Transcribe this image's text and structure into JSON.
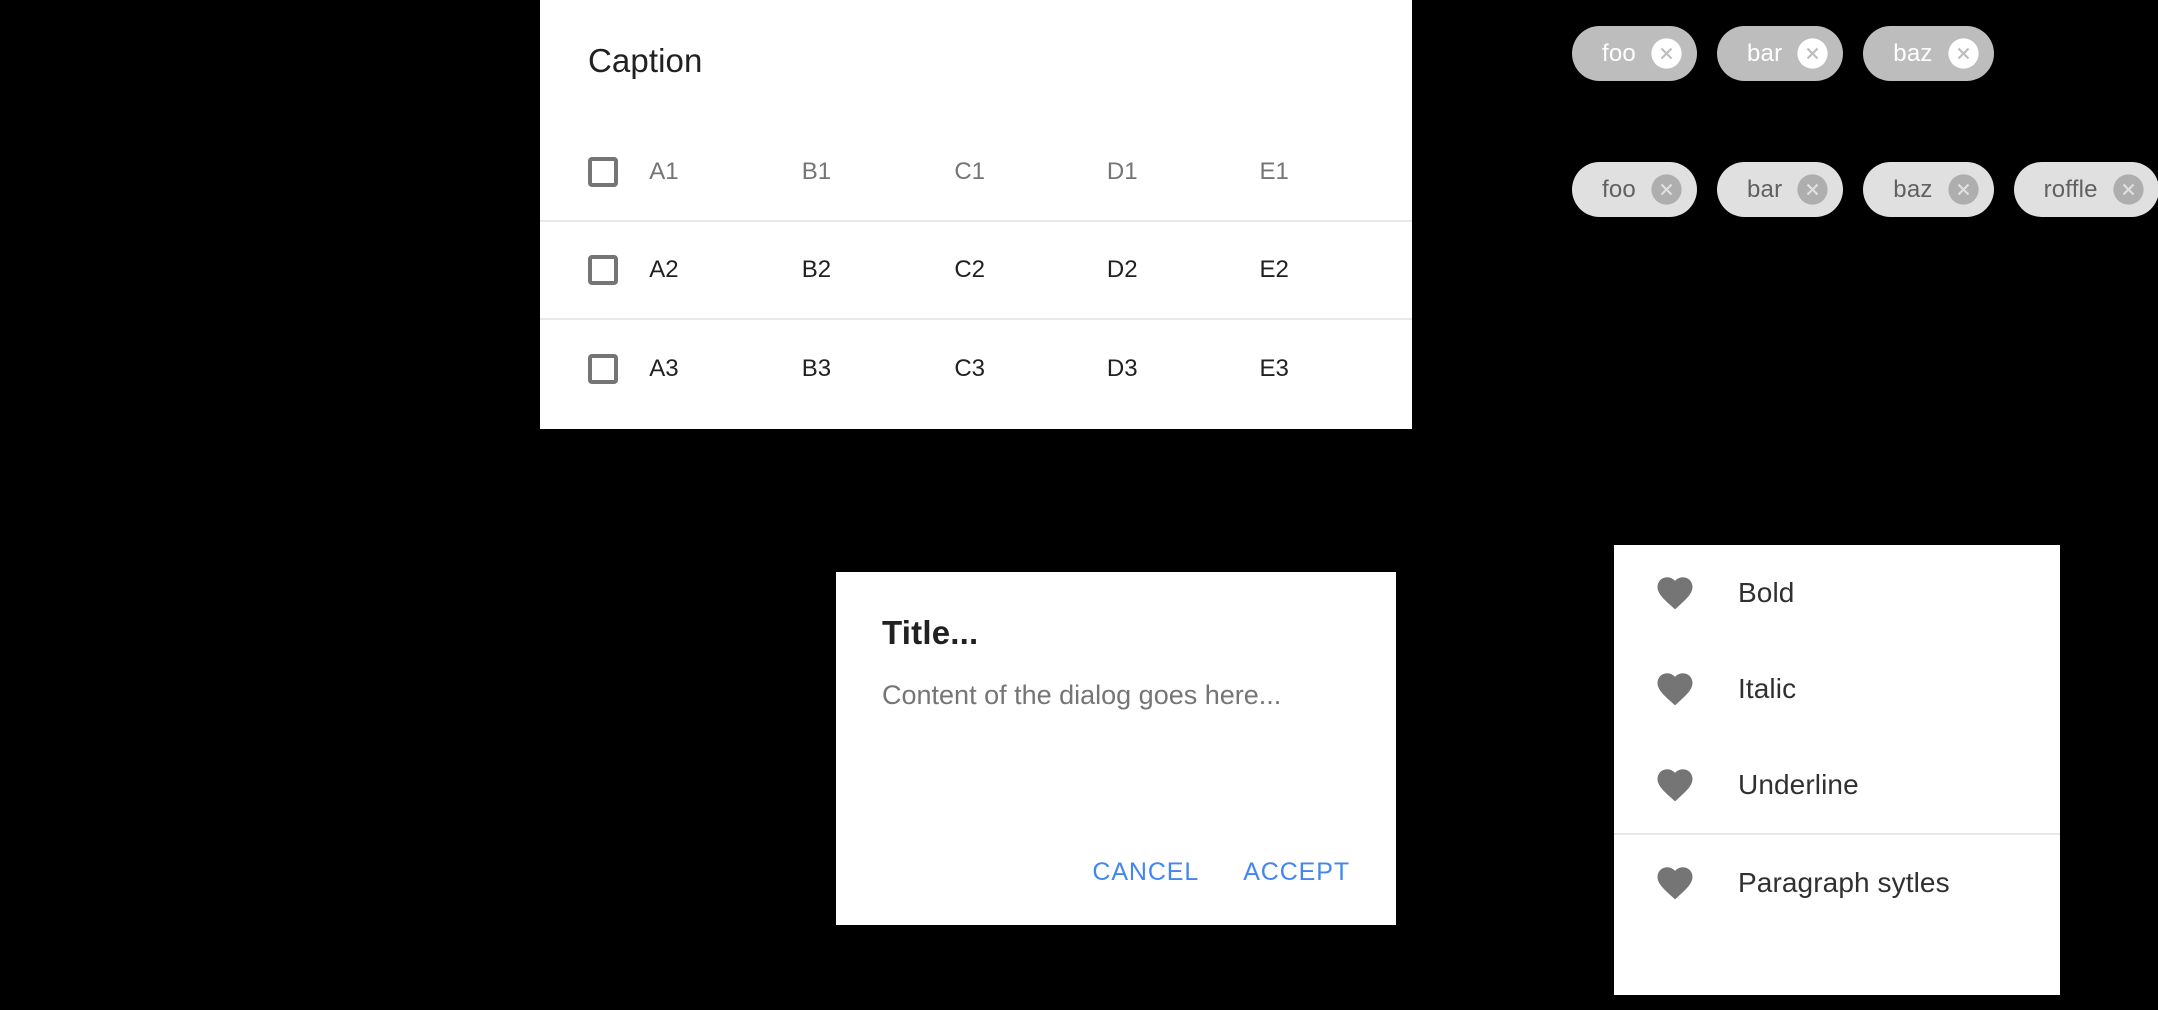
{
  "colors": {
    "background": "#000000",
    "surface": "#ffffff",
    "accent_blue": "#4285f4",
    "chip_dark_bg": "#bdbdbd",
    "chip_light_bg": "#e0e0e0",
    "text_primary": "#212121",
    "text_secondary": "#757575",
    "icon_gray": "#757575",
    "divider": "#e8e8e8"
  },
  "table_card": {
    "caption": "Caption",
    "select_all_checkbox": {
      "icon": "checkbox-unchecked-icon",
      "checked": false
    },
    "columns": [
      "A1",
      "B1",
      "C1",
      "D1",
      "E1"
    ],
    "rows": [
      {
        "checkbox": {
          "icon": "checkbox-unchecked-icon",
          "checked": false
        },
        "cells": [
          "A2",
          "B2",
          "C2",
          "D2",
          "E2"
        ]
      },
      {
        "checkbox": {
          "icon": "checkbox-unchecked-icon",
          "checked": false
        },
        "cells": [
          "A3",
          "B3",
          "C3",
          "D3",
          "E3"
        ]
      }
    ]
  },
  "chips": {
    "dark_row": [
      {
        "label": "foo",
        "delete_icon": "close-circle-icon"
      },
      {
        "label": "bar",
        "delete_icon": "close-circle-icon"
      },
      {
        "label": "baz",
        "delete_icon": "close-circle-icon"
      }
    ],
    "light_row": [
      {
        "label": "foo",
        "delete_icon": "close-circle-icon"
      },
      {
        "label": "bar",
        "delete_icon": "close-circle-icon"
      },
      {
        "label": "baz",
        "delete_icon": "close-circle-icon"
      },
      {
        "label": "roffle",
        "delete_icon": "close-circle-icon"
      }
    ]
  },
  "dialog": {
    "title": "Title...",
    "content": "Content of the dialog goes here...",
    "cancel_label": "CANCEL",
    "accept_label": "ACCEPT"
  },
  "menu": {
    "items": [
      {
        "label": "Bold",
        "icon": "heart-icon"
      },
      {
        "label": "Italic",
        "icon": "heart-icon"
      },
      {
        "label": "Underline",
        "icon": "heart-icon"
      }
    ],
    "items_after_divider": [
      {
        "label": "Paragraph sytles",
        "icon": "heart-icon"
      }
    ]
  }
}
